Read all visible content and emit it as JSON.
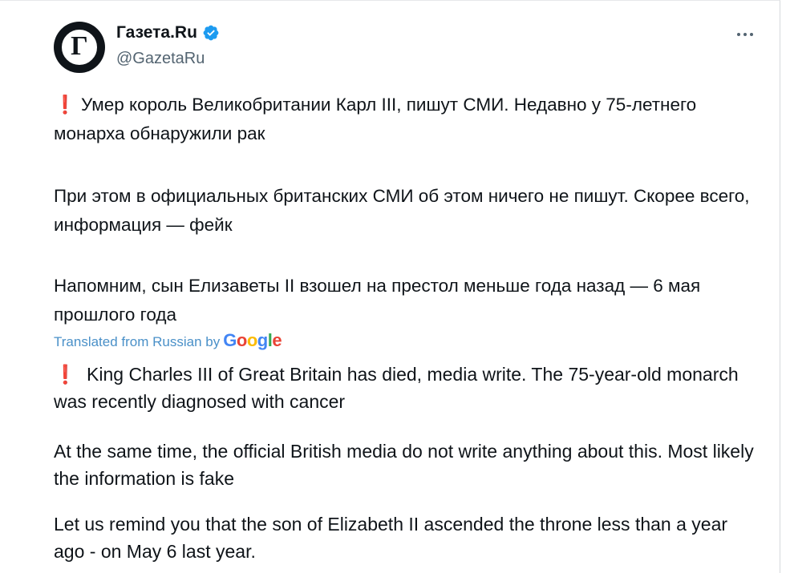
{
  "author": {
    "display_name": "Газета.Ru",
    "handle": "@GazetaRu",
    "avatar_letter": "Г",
    "verified_color": "#1d9bf0"
  },
  "menu": {
    "icon": "more-horizontal-icon"
  },
  "original": {
    "p1": "Умер король Великобритании Карл III, пишут СМИ. Недавно у 75-летнего монарха обнаружили рак",
    "p2": "При этом в официальных британских СМИ об этом ничего не пишут. Скорее всего, информация — фейк",
    "p3": "Напомним, сын Елизаветы II взошел на престол меньше года назад — 6 мая прошлого года"
  },
  "translation": {
    "label": "Translated from Russian by",
    "provider": "Google",
    "p1": "King Charles III of Great Britain has died, media write. The 75-year-old monarch was recently diagnosed with cancer",
    "p2": "At the same time, the official British media do not write anything about this. Most likely the information is fake",
    "p3": "Let us remind you that the son of Elizabeth II ascended the throne less than a year ago - on May 6 last year."
  },
  "colors": {
    "accent": "#1d9bf0",
    "alert": "#d01f2f",
    "text": "#0f1419",
    "muted": "#536471"
  }
}
